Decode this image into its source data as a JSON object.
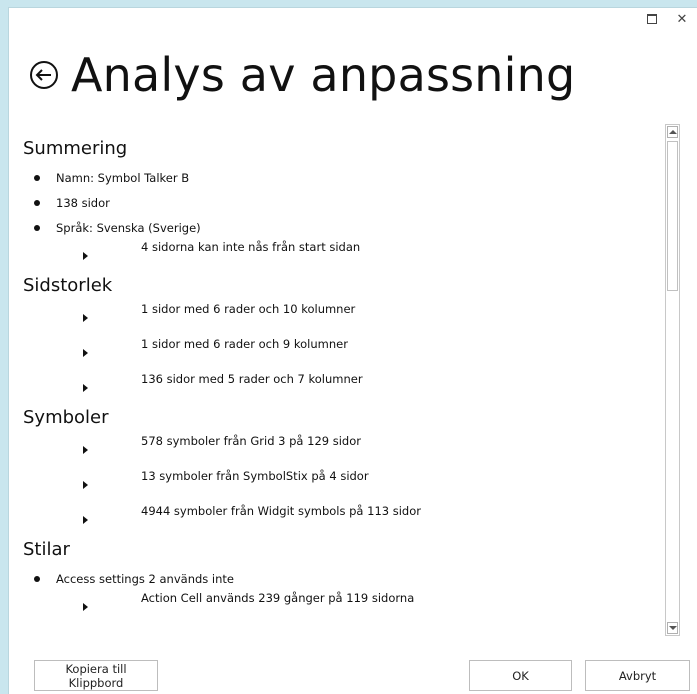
{
  "window": {
    "title": "Analys av anpassning",
    "controls": [
      "maximize-icon",
      "close-icon"
    ],
    "close_glyph": "✕"
  },
  "sections": {
    "summary": {
      "title": "Summering",
      "bullets": [
        "Namn: Symbol Talker B",
        "138 sidor",
        "Språk: Svenska (Sverige)"
      ],
      "sub": [
        "4 sidorna kan inte nås från start sidan"
      ]
    },
    "page_size": {
      "title": "Sidstorlek",
      "sub": [
        "1 sidor med 6 rader och 10 kolumner",
        "1 sidor med 6 rader och 9 kolumner",
        "136 sidor med 5 rader och 7 kolumner"
      ]
    },
    "symbols": {
      "title": "Symboler",
      "sub": [
        "578 symboler från Grid 3 på 129 sidor",
        "13 symboler från SymbolStix på 4 sidor",
        "4944 symboler från Widgit symbols på 113 sidor"
      ]
    },
    "styles": {
      "title": "Stilar",
      "bullets": [
        "Access settings 2 används inte"
      ],
      "sub": [
        "Action Cell används 239 gånger på 119 sidorna"
      ]
    }
  },
  "footer": {
    "copy_label": "Kopiera till Klippbord",
    "ok_label": "OK",
    "cancel_label": "Avbryt"
  },
  "colors": {
    "background": "#c9e6ee",
    "window": "#ffffff",
    "text": "#111111",
    "button_border": "#bdbdbd"
  }
}
